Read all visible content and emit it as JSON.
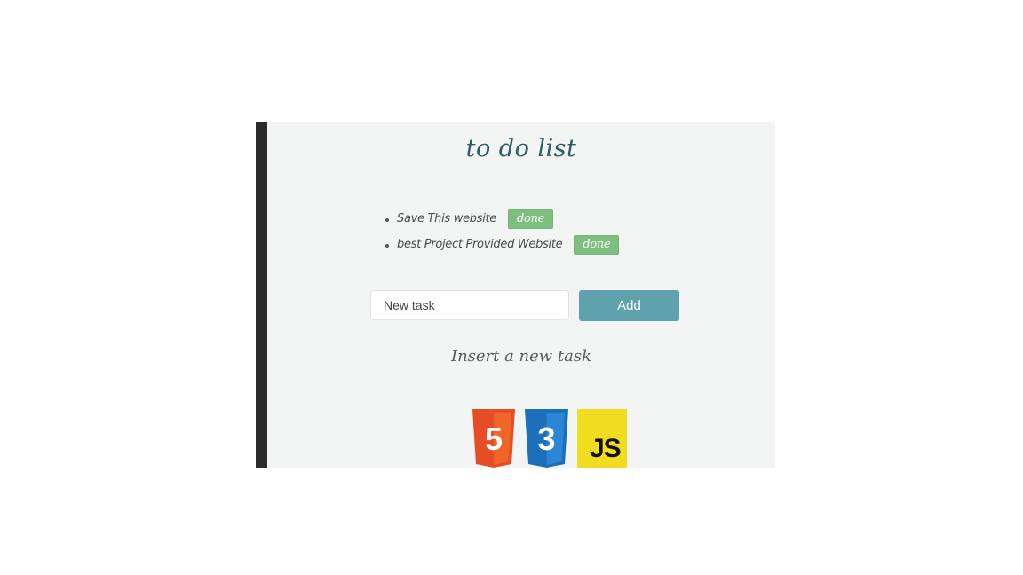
{
  "app": {
    "title": "to do list"
  },
  "tasks": [
    {
      "text": "Save This website",
      "action_label": "done"
    },
    {
      "text": "best Project Provided Website",
      "action_label": "done"
    }
  ],
  "form": {
    "input_value": "New task",
    "add_label": "Add",
    "hint": "Insert a new task"
  },
  "logos": {
    "html_glyph": "5",
    "css_glyph": "3",
    "js_text": "JS"
  },
  "colors": {
    "title": "#2f5d66",
    "done_button": "#7cbf7e",
    "add_button": "#5fa2ae",
    "html5": "#e44d26",
    "css3": "#1c6fb8",
    "js": "#f2dc1f"
  }
}
